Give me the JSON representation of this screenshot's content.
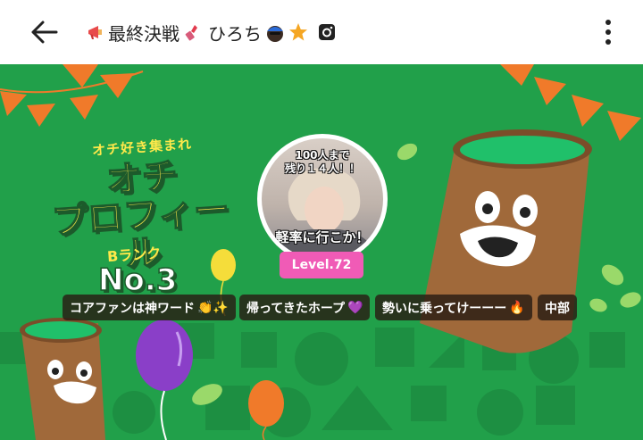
{
  "app_bar": {
    "back_icon": "arrow-left-icon",
    "title": "最終決戦",
    "title_suffix": "ひろち",
    "icons": [
      "megaphone-icon",
      "lipstick-icon",
      "face-cap-icon",
      "star-icon",
      "instagram-icon"
    ],
    "more_icon": "kebab-menu-icon"
  },
  "banner": {
    "tagline": "オチ好き集まれ",
    "headline_line1": "オチ",
    "headline_line2": "プロフィール",
    "rank_label": "Bランク",
    "rank_number": "No.3",
    "avatar_top_text_1": "100人まで",
    "avatar_top_text_2": "残り１４人！！",
    "avatar_bottom_text": "軽率に行こか！",
    "level": "Level.72"
  },
  "chips": [
    {
      "label": "コアファンは神ワード",
      "emoji": "👏✨"
    },
    {
      "label": "帰ってきたホープ",
      "emoji": "💜"
    },
    {
      "label": "勢いに乗ってけーーー",
      "emoji": "🔥"
    },
    {
      "label": "中部",
      "emoji": ""
    }
  ],
  "colors": {
    "banner_green": "#21a04a",
    "pennant_orange": "#f07a2a",
    "level_pink": "#f05bb6",
    "headline_yellow": "#ffe94a"
  }
}
